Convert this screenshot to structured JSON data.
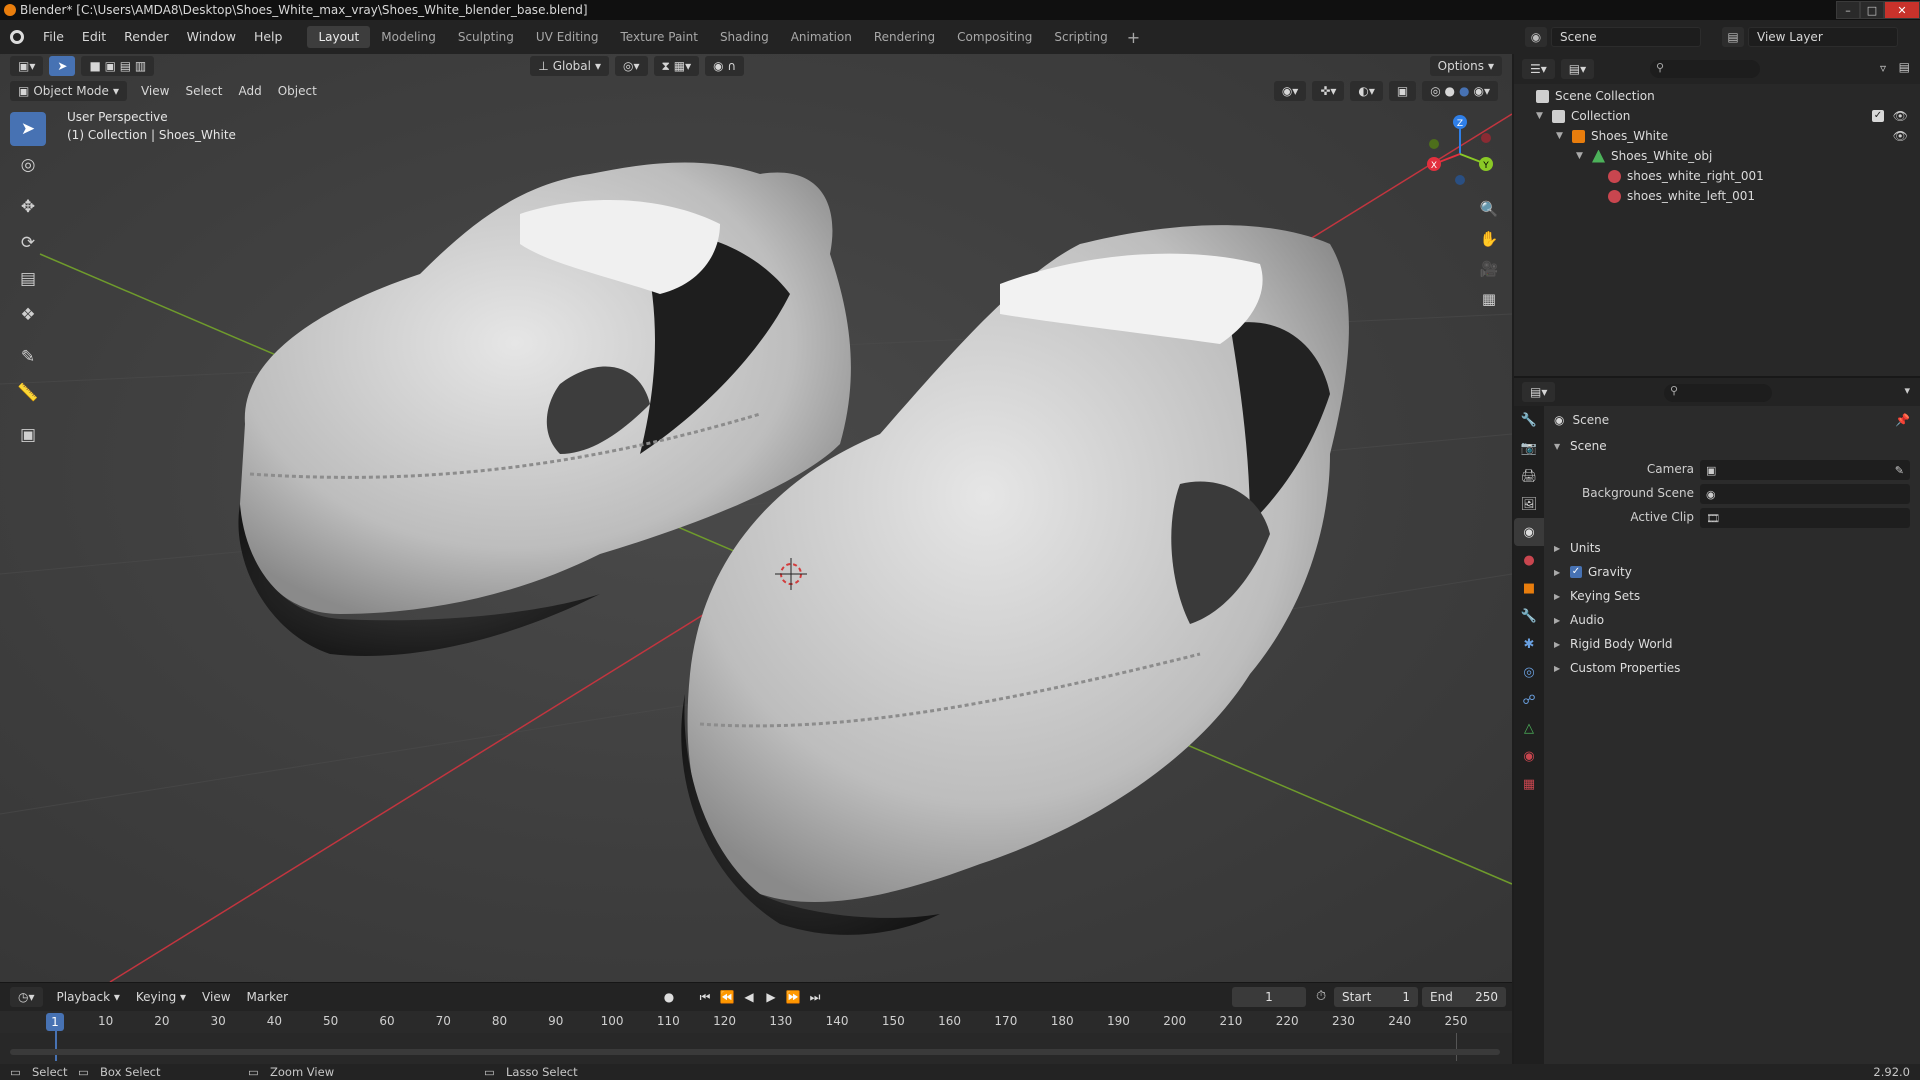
{
  "title_bar": {
    "text": "Blender* [C:\\Users\\AMDA8\\Desktop\\Shoes_White_max_vray\\Shoes_White_blender_base.blend]"
  },
  "menu": {
    "items": [
      "File",
      "Edit",
      "Render",
      "Window",
      "Help"
    ]
  },
  "workspaces": {
    "tabs": [
      "Layout",
      "Modeling",
      "Sculpting",
      "UV Editing",
      "Texture Paint",
      "Shading",
      "Animation",
      "Rendering",
      "Compositing",
      "Scripting"
    ],
    "active": "Layout",
    "add": "+"
  },
  "scene_selector": {
    "value": "Scene"
  },
  "view_layer_selector": {
    "value": "View Layer"
  },
  "viewport": {
    "transform_orientation": "Global",
    "options_label": "Options",
    "mode": "Object Mode",
    "header_menus": [
      "View",
      "Select",
      "Add",
      "Object"
    ],
    "overlay_line1": "User Perspective",
    "overlay_line2": "(1) Collection | Shoes_White",
    "gizmo_labels": {
      "x": "X",
      "y": "Y",
      "z": "Z"
    }
  },
  "outliner": {
    "rows": [
      {
        "label": "Scene Collection"
      },
      {
        "label": "Collection"
      },
      {
        "label": "Shoes_White"
      },
      {
        "label": "Shoes_White_obj"
      },
      {
        "label": "shoes_white_right_001"
      },
      {
        "label": "shoes_white_left_001"
      }
    ]
  },
  "properties": {
    "context": "Scene",
    "panel": "Scene",
    "fields": [
      {
        "label": "Camera"
      },
      {
        "label": "Background Scene"
      },
      {
        "label": "Active Clip"
      }
    ],
    "subpanels": [
      "Units",
      "Gravity",
      "Keying Sets",
      "Audio",
      "Rigid Body World",
      "Custom Properties"
    ]
  },
  "timeline": {
    "menus": [
      "Playback",
      "Keying",
      "View",
      "Marker"
    ],
    "current_frame": "1",
    "start_label": "Start",
    "start_value": "1",
    "end_label": "End",
    "end_value": "250",
    "ticks": [
      "1",
      "10",
      "20",
      "30",
      "40",
      "50",
      "60",
      "70",
      "80",
      "90",
      "100",
      "110",
      "120",
      "130",
      "140",
      "150",
      "160",
      "170",
      "180",
      "190",
      "200",
      "210",
      "220",
      "230",
      "240",
      "250"
    ]
  },
  "status_bar": {
    "select": "Select",
    "box_select": "Box Select",
    "zoom_view": "Zoom View",
    "lasso_select": "Lasso Select",
    "version": "2.92.0"
  },
  "colors": {
    "accent": "#4772b3",
    "axis_x": "#e2303e",
    "axis_y": "#8ac926",
    "axis_z": "#2f7fe8",
    "origin": "#e87d0d"
  }
}
